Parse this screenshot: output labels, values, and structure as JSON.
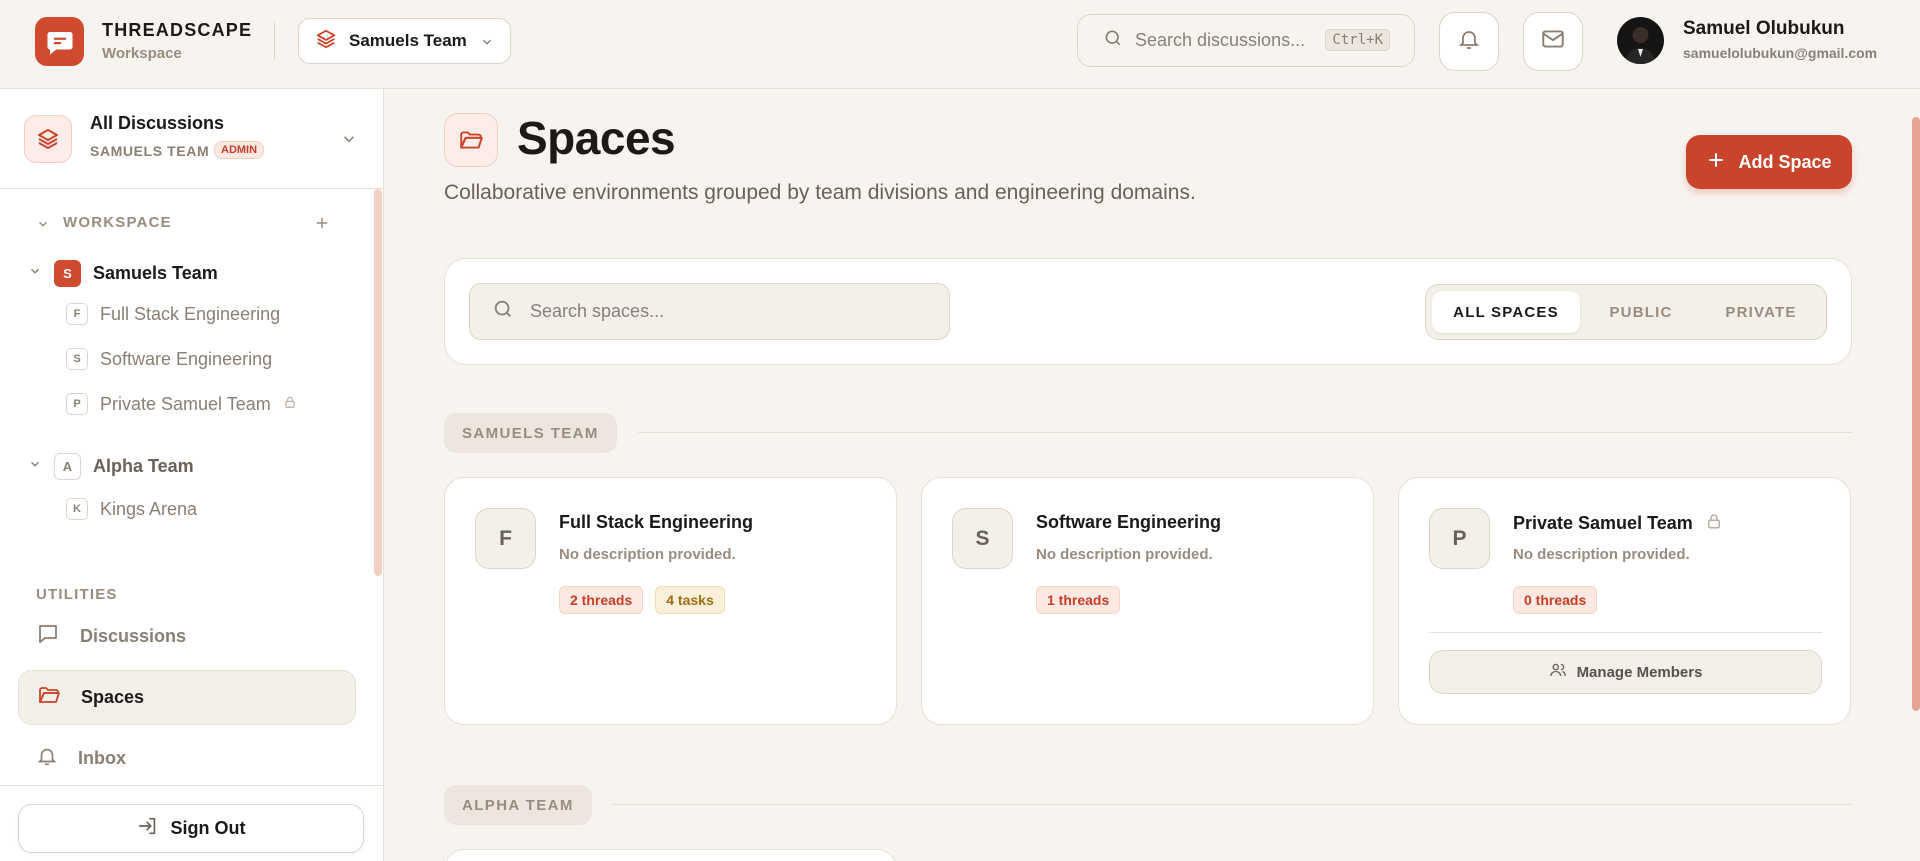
{
  "brand": {
    "title": "THREADSCAPE",
    "subtitle": "Workspace"
  },
  "team_switcher": {
    "label": "Samuels Team"
  },
  "top_search": {
    "placeholder": "Search discussions...",
    "shortcut": "Ctrl+K"
  },
  "user": {
    "name": "Samuel Olubukun",
    "email": "samuelolubukun@gmail.com"
  },
  "sidebar": {
    "header": {
      "title": "All Discussions",
      "team": "SAMUELS TEAM",
      "role": "ADMIN"
    },
    "workspace_label": "WORKSPACE",
    "teams": [
      {
        "badge": "S",
        "name": "Samuels Team",
        "spaces": [
          {
            "badge": "F",
            "name": "Full Stack Engineering"
          },
          {
            "badge": "S",
            "name": "Software Engineering"
          },
          {
            "badge": "P",
            "name": "Private Samuel Team",
            "locked": true
          }
        ]
      },
      {
        "badge": "A",
        "name": "Alpha Team",
        "spaces": [
          {
            "badge": "K",
            "name": "Kings Arena"
          }
        ]
      }
    ],
    "utilities_label": "UTILITIES",
    "nav": [
      {
        "label": "Discussions",
        "icon": "message-icon"
      },
      {
        "label": "Spaces",
        "icon": "folder-icon",
        "active": true
      },
      {
        "label": "Inbox",
        "icon": "bell-icon"
      }
    ],
    "sign_out": "Sign Out"
  },
  "main": {
    "title": "Spaces",
    "subtitle": "Collaborative environments grouped by team divisions and engineering domains.",
    "add_button": "Add Space",
    "search_placeholder": "Search spaces...",
    "filters": [
      "ALL SPACES",
      "PUBLIC",
      "PRIVATE"
    ],
    "active_filter": "ALL SPACES",
    "groups": [
      {
        "label": "SAMUELS TEAM",
        "spaces": [
          {
            "letter": "F",
            "title": "Full Stack Engineering",
            "description": "No description provided.",
            "threads": "2 threads",
            "tasks": "4 tasks"
          },
          {
            "letter": "S",
            "title": "Software Engineering",
            "description": "No description provided.",
            "threads": "1 threads"
          },
          {
            "letter": "P",
            "title": "Private Samuel Team",
            "description": "No description provided.",
            "threads": "0 threads",
            "locked": true,
            "action": "Manage Members"
          }
        ]
      },
      {
        "label": "ALPHA TEAM"
      }
    ]
  },
  "colors": {
    "accent": "#c9442b",
    "background": "#f7f4f0",
    "muted": "#9a8c7e"
  }
}
